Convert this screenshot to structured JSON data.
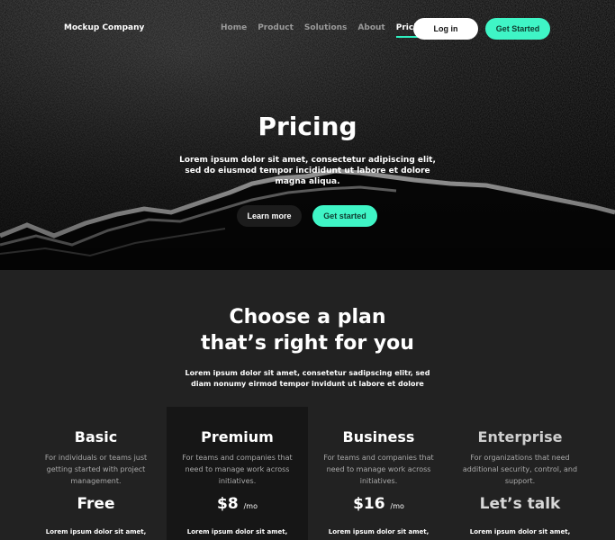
{
  "header": {
    "brand": "Mockup Company",
    "nav": [
      "Home",
      "Product",
      "Solutions",
      "About",
      "Pricing"
    ],
    "active_nav": "Pricing",
    "login_label": "Log in",
    "get_started_label": "Get Started"
  },
  "hero": {
    "title": "Pricing",
    "subtitle": "Lorem ipsum dolor sit amet, consectetur adipiscing elit, sed do eiusmod tempor incididunt ut labore et dolore magna aliqua.",
    "learn_more_label": "Learn more",
    "get_started_label": "Get started"
  },
  "plans_section": {
    "heading_line1": "Choose a plan",
    "heading_line2": "that’s right for you",
    "subtitle": "Lorem ipsum dolor sit amet, consetetur sadipscing elitr, sed diam nonumy eirmod tempor invidunt ut labore et dolore"
  },
  "plans": [
    {
      "name": "Basic",
      "description": "For individuals or teams just getting started with project management.",
      "price": "Free",
      "unit": "",
      "feature": "Lorem ipsum dolor sit amet,"
    },
    {
      "name": "Premium",
      "description": "For teams and companies that need to manage work across initiatives.",
      "price": "$8",
      "unit": "/mo",
      "feature": "Lorem ipsum dolor sit amet,"
    },
    {
      "name": "Business",
      "description": "For teams and companies that need to manage work across initiatives.",
      "price": "$16",
      "unit": "/mo",
      "feature": "Lorem ipsum dolor sit amet,"
    },
    {
      "name": "Enterprise",
      "description": "For organizations that need additional security, control, and support.",
      "price": "Let’s talk",
      "unit": "",
      "feature": "Lorem ipsum dolor sit amet,"
    }
  ],
  "colors": {
    "accent": "#3ff5c6",
    "background": "#222222",
    "featured_card": "#161616"
  }
}
